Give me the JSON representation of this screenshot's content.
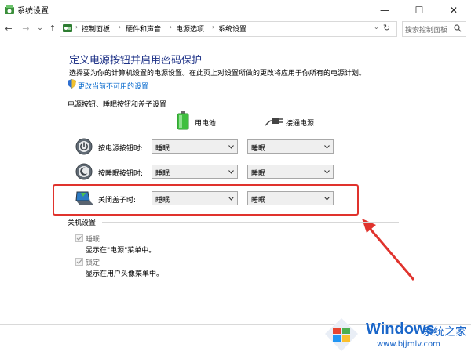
{
  "window": {
    "title": "系统设置",
    "minimize": "—",
    "maximize": "☐",
    "close": "✕"
  },
  "nav": {
    "back": "←",
    "forward": "→",
    "dropdown": "⌄",
    "up": "↑",
    "breadcrumbs": [
      "控制面板",
      "硬件和声音",
      "电源选项",
      "系统设置"
    ],
    "refresh": "↻",
    "search_placeholder": "搜索控制面板"
  },
  "content": {
    "title": "定义电源按钮并启用密码保护",
    "description": "选择要为你的计算机设置的电源设置。在此页上对设置所做的更改将应用于你所有的电源计划。",
    "change_link": "更改当前不可用的设置",
    "section_buttons": "电源按钮、睡眠按钮和盖子设置",
    "col_battery": "用电池",
    "col_plugged": "接通电源",
    "rows": [
      {
        "label": "按电源按钮时:",
        "battery": "睡眠",
        "plugged": "睡眠"
      },
      {
        "label": "按睡眠按钮时:",
        "battery": "睡眠",
        "plugged": "睡眠"
      },
      {
        "label": "关闭盖子时:",
        "battery": "睡眠",
        "plugged": "睡眠"
      }
    ],
    "section_shutdown": "关机设置",
    "shutdown_items": [
      {
        "label": "睡眠",
        "sub": "显示在\"电源\"菜单中。",
        "checked": true
      },
      {
        "label": "锁定",
        "sub": "显示在用户头像菜单中。",
        "checked": true
      }
    ]
  },
  "watermark": {
    "brand": "Windows",
    "cn": "系统之家",
    "url": "www.bjjmlv.com"
  },
  "colors": {
    "title": "#1e3287",
    "link": "#0066cc",
    "highlight": "#e0332d",
    "watermark": "#1a66c9"
  }
}
